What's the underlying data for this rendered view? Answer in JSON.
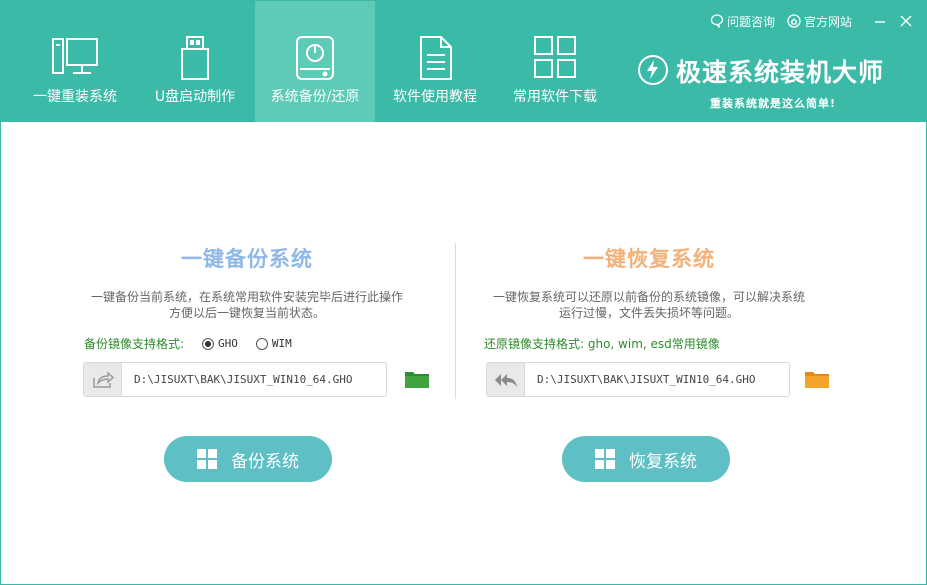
{
  "header": {
    "nav": [
      {
        "label": "一键重装系统",
        "icon": "monitor-icon"
      },
      {
        "label": "U盘启动制作",
        "icon": "usb-drive-icon"
      },
      {
        "label": "系统备份/还原",
        "icon": "backup-drive-icon"
      },
      {
        "label": "软件使用教程",
        "icon": "document-icon"
      },
      {
        "label": "常用软件下载",
        "icon": "grid-apps-icon"
      }
    ],
    "active_index": 2,
    "links": {
      "faq": "问题咨询",
      "website": "官方网站"
    },
    "brand_title": "极速系统装机大师",
    "brand_slogan": "重装系统就是这么简单!"
  },
  "backup": {
    "title": "一键备份系统",
    "desc_line1": "一键备份当前系统，在系统常用软件安装完毕后进行此操作",
    "desc_line2": "方便以后一键恢复当前状态。",
    "format_label": "备份镜像支持格式:",
    "option_gho": "GHO",
    "option_wim": "WIM",
    "selected": "GHO",
    "path": "D:\\JISUXT\\BAK\\JISUXT_WIN10_64.GHO",
    "button": "备份系统",
    "title_color": "#8fb8e6",
    "folder_color": "#2e8b2e"
  },
  "restore": {
    "title": "一键恢复系统",
    "desc_line1": "一键恢复系统可以还原以前备份的系统镜像，可以解决系统",
    "desc_line2": "运行过慢，文件丢失损坏等问题。",
    "format_label": "还原镜像支持格式: gho, wim, esd常用镜像",
    "path": "D:\\JISUXT\\BAK\\JISUXT_WIN10_64.GHO",
    "button": "恢复系统",
    "title_color": "#f2b27a",
    "folder_color": "#f39c1f"
  },
  "colors": {
    "header_bg": "#3cbaa8",
    "active_tab": "#5ecab8",
    "button_bg": "#5ec0c4"
  }
}
